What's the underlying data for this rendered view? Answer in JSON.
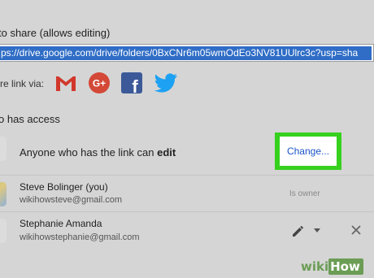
{
  "share_section": {
    "title": "to share (allows editing)",
    "link_url": "ps://drive.google.com/drive/folders/0BxCNr6m05wmOdEo3NV81UUlrc3c?usp=sha"
  },
  "share_via": {
    "label": "re link via:",
    "icons": [
      "gmail-icon",
      "google-plus-icon",
      "facebook-icon",
      "twitter-icon"
    ],
    "gplus_text": "G+",
    "facebook_text": "f"
  },
  "access": {
    "title": "o has access",
    "link_access_prefix": "Anyone who has the link can ",
    "link_access_bold": "edit",
    "change_label": "Change..."
  },
  "people": [
    {
      "name": "Steve Bolinger (you)",
      "email": "wikihowsteve@gmail.com",
      "role": "Is owner"
    },
    {
      "name": "Stephanie Amanda",
      "email": "wikihowstephanie@gmail.com"
    }
  ],
  "watermark": {
    "wiki": "wiki",
    "how": "How"
  },
  "colors": {
    "background": "#d5d5d5",
    "selection": "#2f6dc6",
    "highlight": "#35d11d",
    "link_blue": "#1a53c8",
    "gmail_red": "#d1382b",
    "gplus_red": "#d34836",
    "facebook_blue": "#3b5998",
    "twitter_blue": "#1da1f2"
  }
}
